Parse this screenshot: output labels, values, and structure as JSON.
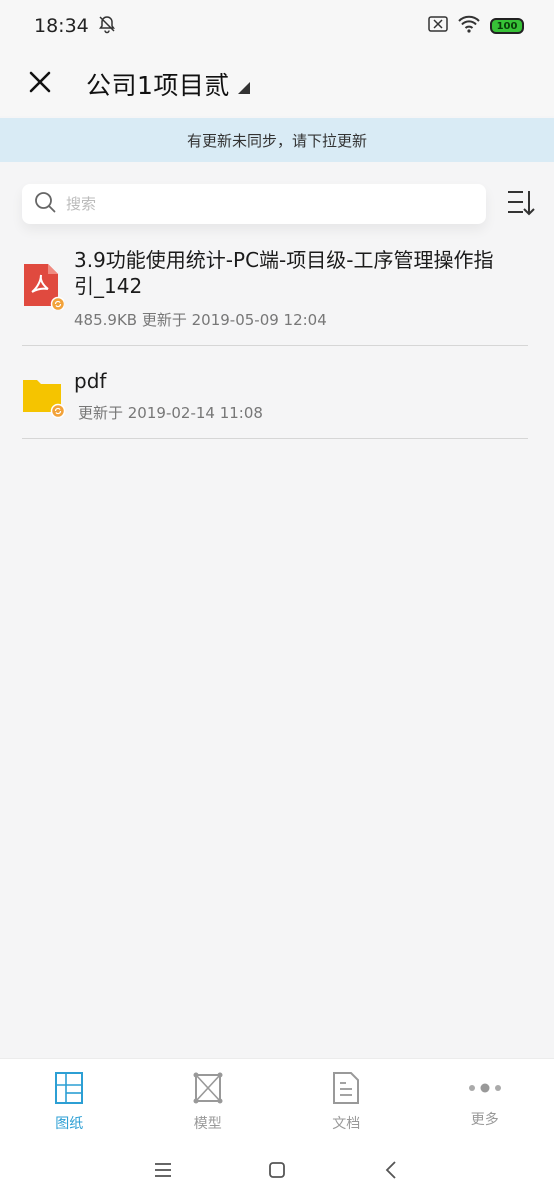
{
  "status_bar": {
    "time": "18:34",
    "battery": "100"
  },
  "header": {
    "title": "公司1项目贰"
  },
  "sync_banner": {
    "text": "有更新未同步，请下拉更新"
  },
  "search": {
    "placeholder": "搜索",
    "value": ""
  },
  "files": [
    {
      "type": "pdf",
      "icon": "pdf-file-icon",
      "title": "3.9功能使用统计-PC端-项目级-工序管理操作指引_142",
      "meta": "485.9KB 更新于 2019-05-09 12:04"
    },
    {
      "type": "folder",
      "icon": "folder-icon",
      "title": "pdf",
      "meta": "更新于 2019-02-14 11:08"
    }
  ],
  "bottom_nav": {
    "items": [
      {
        "label": "图纸",
        "icon": "drawing-icon",
        "active": true
      },
      {
        "label": "模型",
        "icon": "model-icon",
        "active": false
      },
      {
        "label": "文档",
        "icon": "document-icon",
        "active": false
      },
      {
        "label": "更多",
        "icon": "more-dots-icon",
        "active": false
      }
    ]
  },
  "colors": {
    "accent": "#2c9fd4",
    "banner": "#d9ebf5",
    "pdf_red": "#e04a3f",
    "folder_yellow": "#f5c400",
    "badge_orange": "#f2a23a"
  }
}
